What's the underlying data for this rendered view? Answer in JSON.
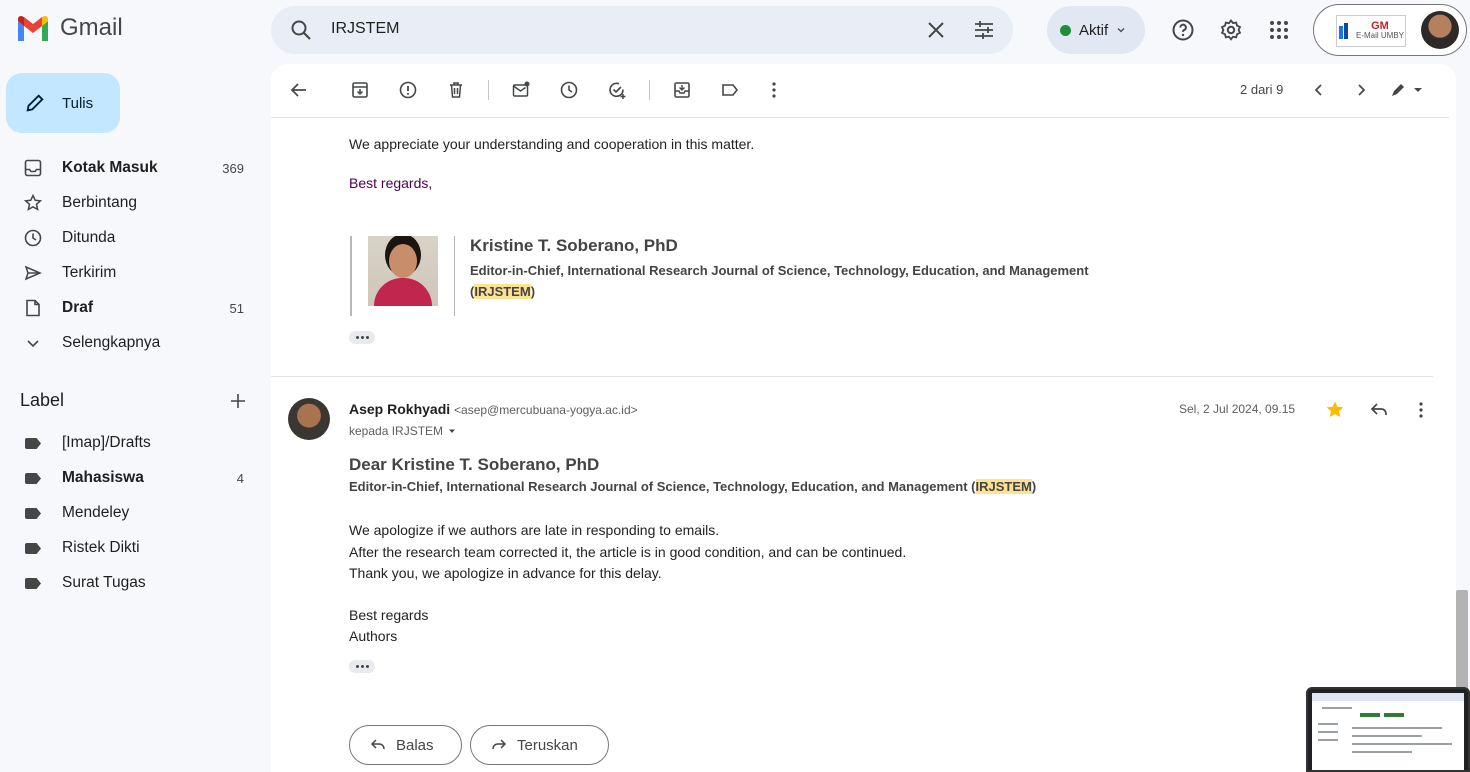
{
  "app": {
    "name": "Gmail"
  },
  "search": {
    "query": "IRJSTEM"
  },
  "status": {
    "label": "Aktif"
  },
  "account": {
    "org_logo_text": "E-Mail UMBY"
  },
  "compose": {
    "label": "Tulis"
  },
  "nav": [
    {
      "label": "Kotak Masuk",
      "count": "369",
      "icon": "inbox-icon",
      "bold": true
    },
    {
      "label": "Berbintang",
      "count": "",
      "icon": "star-icon",
      "bold": false
    },
    {
      "label": "Ditunda",
      "count": "",
      "icon": "clock-icon",
      "bold": false
    },
    {
      "label": "Terkirim",
      "count": "",
      "icon": "send-icon",
      "bold": false
    },
    {
      "label": "Draf",
      "count": "51",
      "icon": "draft-icon",
      "bold": true
    },
    {
      "label": "Selengkapnya",
      "count": "",
      "icon": "chevron-down-icon",
      "bold": false
    }
  ],
  "labels": {
    "title": "Label",
    "items": [
      {
        "label": "[Imap]/Drafts",
        "count": "",
        "bold": false
      },
      {
        "label": "Mahasiswa",
        "count": "4",
        "bold": true
      },
      {
        "label": "Mendeley",
        "count": "",
        "bold": false
      },
      {
        "label": "Ristek Dikti",
        "count": "",
        "bold": false
      },
      {
        "label": "Surat Tugas",
        "count": "",
        "bold": false
      }
    ]
  },
  "toolbar": {
    "pager": "2 dari 9"
  },
  "message1": {
    "line1": "We appreciate your understanding and cooperation in this matter.",
    "closing": "Best regards,",
    "sig_name": "Kristine T. Soberano, PhD",
    "sig_title": "Editor-in-Chief, International Research Journal of Science, Technology, Education, and Management",
    "sig_open": "(",
    "sig_abbr": "IRJSTEM",
    "sig_close": ")"
  },
  "message2": {
    "sender_name": "Asep Rokhyadi",
    "sender_email": "<asep@mercubuana-yogya.ac.id>",
    "recipient": "kepada IRJSTEM",
    "date": "Sel, 2 Jul 2024, 09.15",
    "greeting": "Dear Kristine T. Soberano, PhD",
    "title_prefix": "Editor-in-Chief, International Research Journal of Science, Technology, Education, and Management (",
    "title_abbr": "IRJSTEM",
    "title_suffix": ")",
    "body": [
      "We apologize if we authors are late in responding to emails.",
      "After the research team corrected it, the article is in good condition, and can be continued.",
      "Thank you, we apologize in advance for this delay."
    ],
    "closing1": "Best regards",
    "closing2": "Authors"
  },
  "actions": {
    "reply": "Balas",
    "forward": "Teruskan"
  },
  "colors": {
    "compose_bg": "#c2e7ff",
    "highlight": "#fde293",
    "status_dot": "#1e8e3e",
    "star": "#fbbc04",
    "closing_purple": "#500050"
  }
}
